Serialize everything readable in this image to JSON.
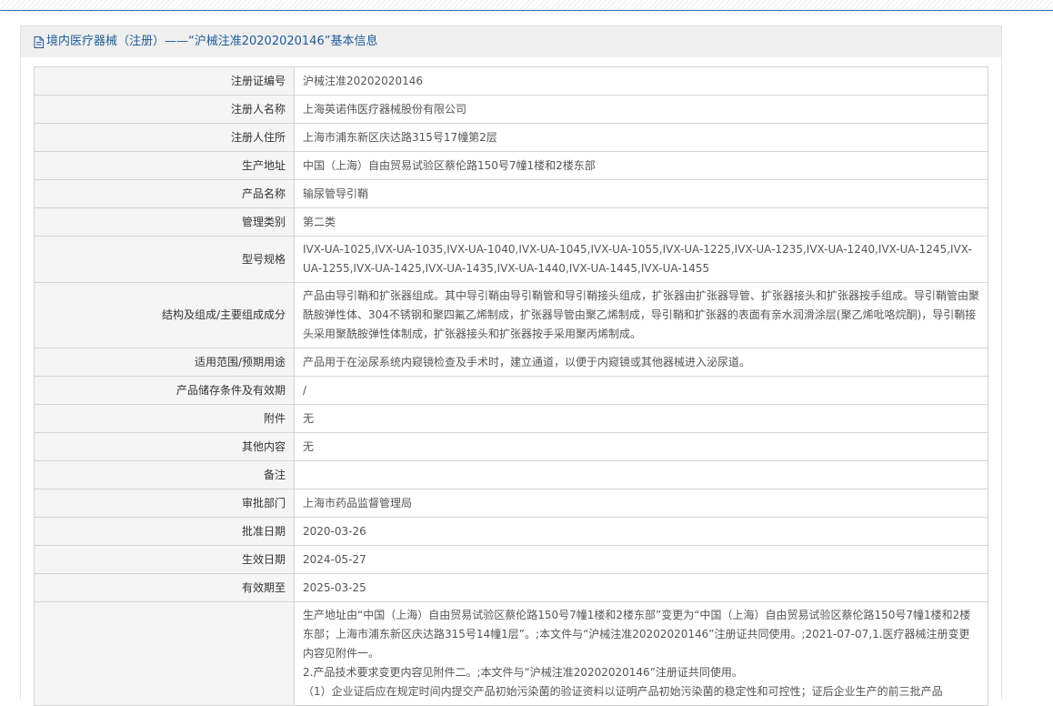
{
  "page": {
    "title": "境内医疗器械（注册）——“沪械注准20202020146”基本信息",
    "title_icon": "document-icon",
    "accent_color": "#1e5c99"
  },
  "rows": [
    {
      "label": "注册证编号",
      "value": "沪械注准20202020146"
    },
    {
      "label": "注册人名称",
      "value": "上海英诺伟医疗器械股份有限公司"
    },
    {
      "label": "注册人住所",
      "value": "上海市浦东新区庆达路315号17幢第2层"
    },
    {
      "label": "生产地址",
      "value": "中国（上海）自由贸易试验区蔡伦路150号7幢1楼和2楼东部"
    },
    {
      "label": "产品名称",
      "value": "输尿管导引鞘"
    },
    {
      "label": "管理类别",
      "value": "第二类"
    },
    {
      "label": "型号规格",
      "value": "IVX-UA-1025,IVX-UA-1035,IVX-UA-1040,IVX-UA-1045,IVX-UA-1055,IVX-UA-1225,IVX-UA-1235,IVX-UA-1240,IVX-UA-1245,IVX-UA-1255,IVX-UA-1425,IVX-UA-1435,IVX-UA-1440,IVX-UA-1445,IVX-UA-1455"
    },
    {
      "label": "结构及组成/主要组成成分",
      "value": "产品由导引鞘和扩张器组成。其中导引鞘由导引鞘管和导引鞘接头组成，扩张器由扩张器导管、扩张器接头和扩张器按手组成。导引鞘管由聚酰胺弹性体、304不锈钢和聚四氟乙烯制成，扩张器导管由聚乙烯制成，导引鞘和扩张器的表面有亲水润滑涂层(聚乙烯吡咯烷酮)，导引鞘接头采用聚酰胺弹性体制成，扩张器接头和扩张器按手采用聚丙烯制成。"
    },
    {
      "label": "适用范围/预期用途",
      "value": "产品用于在泌尿系统内窥镜检查及手术时，建立通道，以便于内窥镜或其他器械进入泌尿道。"
    },
    {
      "label": "产品储存条件及有效期",
      "value": "/"
    },
    {
      "label": "附件",
      "value": "无"
    },
    {
      "label": "其他内容",
      "value": "无"
    },
    {
      "label": "备注",
      "value": ""
    },
    {
      "label": "审批部门",
      "value": "上海市药品监督管理局"
    },
    {
      "label": "批准日期",
      "value": "2020-03-26"
    },
    {
      "label": "生效日期",
      "value": "2024-05-27"
    },
    {
      "label": "有效期至",
      "value": "2025-03-25"
    }
  ],
  "change_history": {
    "label": "",
    "lines": [
      "生产地址由“中国（上海）自由贸易试验区蔡伦路150号7幢1楼和2楼东部”变更为“中国（上海）自由贸易试验区蔡伦路150号7幢1楼和2楼东部；上海市浦东新区庆达路315号14幢1层”。;本文件与“沪械注准20202020146”注册证共同使用。;2021-07-07,1.医疗器械注册变更内容见附件一。",
      "2.产品技术要求变更内容见附件二。;本文件与“沪械注准20202020146”注册证共同使用。",
      "（1）企业证后应在规定时间内提交产品初始污染菌的验证资料以证明产品初始污染菌的稳定性和可控性；证后企业生产的前三批产品"
    ]
  }
}
